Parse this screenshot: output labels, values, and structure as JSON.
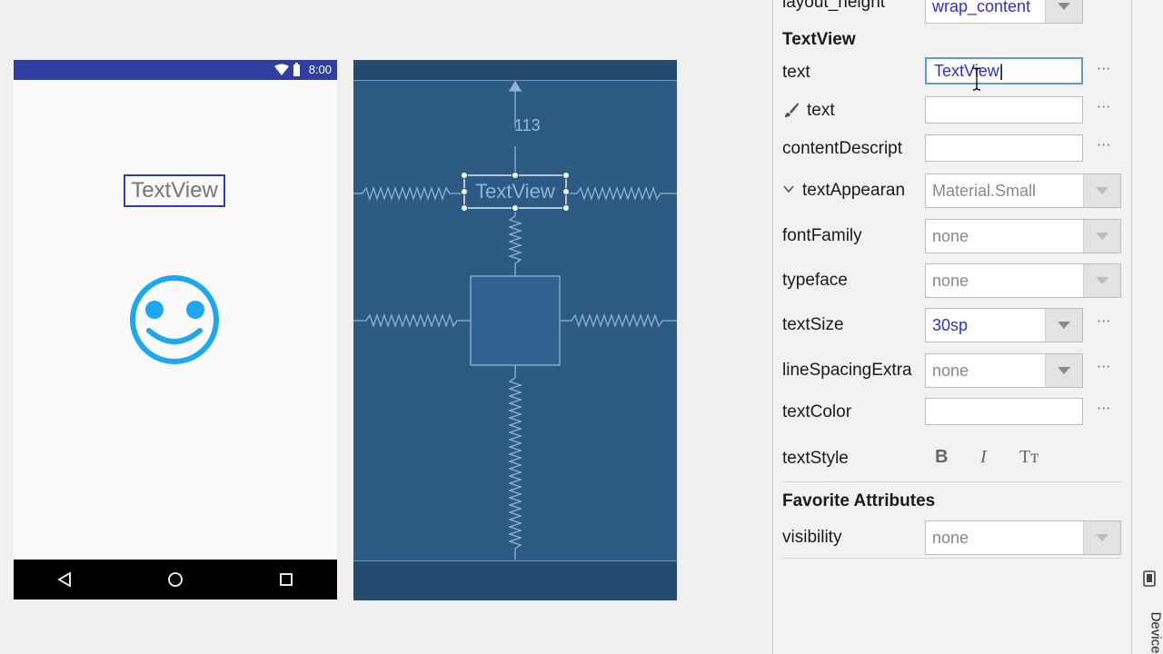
{
  "design": {
    "status_time": "8:00",
    "textview_text": "TextView"
  },
  "blueprint": {
    "margin_value": "113",
    "textview_text": "TextView"
  },
  "panel": {
    "layout_height": {
      "label": "layout_height",
      "value": "wrap_content"
    },
    "section_textview": "TextView",
    "rows": {
      "text": {
        "label": "text",
        "value": "TextView"
      },
      "tools_text": {
        "label": "text",
        "value": ""
      },
      "content_description": {
        "label": "contentDescript",
        "value": ""
      },
      "text_appearance": {
        "label": "textAppearan",
        "value": "Material.Small"
      },
      "font_family": {
        "label": "fontFamily",
        "value": "none"
      },
      "typeface": {
        "label": "typeface",
        "value": "none"
      },
      "text_size": {
        "label": "textSize",
        "value": "30sp"
      },
      "line_spacing": {
        "label": "lineSpacingExtra",
        "value": "none"
      },
      "text_color": {
        "label": "textColor",
        "value": ""
      },
      "text_style": {
        "label": "textStyle",
        "bold": "B",
        "italic": "I",
        "caps": "Tт"
      }
    },
    "section_favorite": "Favorite Attributes",
    "visibility": {
      "label": "visibility",
      "value": "none"
    },
    "more_glyph": "···"
  },
  "side_tab": {
    "label": "Device"
  },
  "colors": {
    "primary_dark": "#303f9f",
    "blueprint_bg": "#2d5a83",
    "blueprint_line": "#8fb2d6",
    "accent_text": "#2e2ed8",
    "smiley": "#1ba8f0"
  }
}
